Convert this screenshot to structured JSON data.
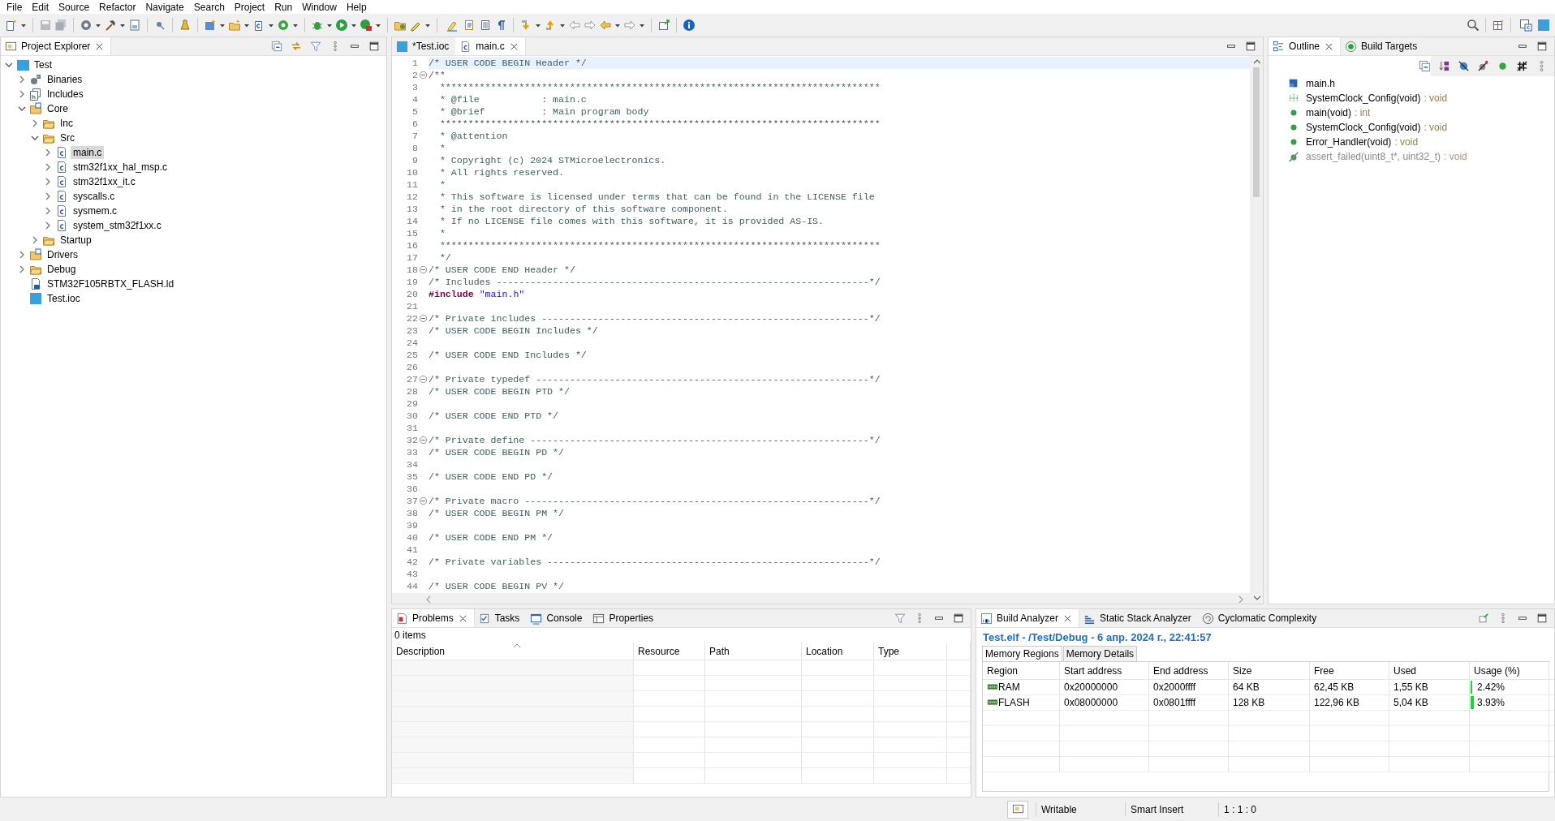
{
  "menu": [
    "File",
    "Edit",
    "Source",
    "Refactor",
    "Navigate",
    "Search",
    "Project",
    "Run",
    "Window",
    "Help"
  ],
  "project_explorer": {
    "title": "Project Explorer",
    "tree": [
      {
        "label": "Test",
        "kind": "project",
        "expanded": true,
        "selected": false,
        "children": [
          {
            "label": "Binaries",
            "kind": "binaries",
            "expanded": false,
            "selected": false
          },
          {
            "label": "Includes",
            "kind": "includes",
            "expanded": false,
            "selected": false
          },
          {
            "label": "Core",
            "kind": "source-folder",
            "expanded": true,
            "selected": false,
            "children": [
              {
                "label": "Inc",
                "kind": "folder",
                "expanded": false,
                "selected": false
              },
              {
                "label": "Src",
                "kind": "folder",
                "expanded": true,
                "selected": false,
                "children": [
                  {
                    "label": "main.c",
                    "kind": "c-file",
                    "expanded": false,
                    "selected": true
                  },
                  {
                    "label": "stm32f1xx_hal_msp.c",
                    "kind": "c-file",
                    "expanded": false,
                    "selected": false
                  },
                  {
                    "label": "stm32f1xx_it.c",
                    "kind": "c-file",
                    "expanded": false,
                    "selected": false
                  },
                  {
                    "label": "syscalls.c",
                    "kind": "c-file",
                    "expanded": false,
                    "selected": false
                  },
                  {
                    "label": "sysmem.c",
                    "kind": "c-file",
                    "expanded": false,
                    "selected": false
                  },
                  {
                    "label": "system_stm32f1xx.c",
                    "kind": "c-file",
                    "expanded": false,
                    "selected": false
                  }
                ]
              },
              {
                "label": "Startup",
                "kind": "folder",
                "expanded": false,
                "selected": false
              }
            ]
          },
          {
            "label": "Drivers",
            "kind": "source-folder",
            "expanded": false,
            "selected": false
          },
          {
            "label": "Debug",
            "kind": "folder",
            "expanded": false,
            "selected": false
          },
          {
            "label": "STM32F105RBTX_FLASH.ld",
            "kind": "linker-file",
            "expanded": false,
            "selected": false
          },
          {
            "label": "Test.ioc",
            "kind": "mx-file",
            "expanded": false,
            "selected": false
          }
        ]
      }
    ]
  },
  "editor": {
    "tabs": [
      {
        "label": "*Test.ioc",
        "kind": "mx",
        "selected": false
      },
      {
        "label": "main.c",
        "kind": "c",
        "selected": true
      }
    ],
    "lines": [
      {
        "n": "1",
        "kind": "comment",
        "text": "/* USER CODE BEGIN Header */",
        "fold": false,
        "current": true
      },
      {
        "n": "2",
        "kind": "comment",
        "text": "/**",
        "fold": true,
        "current": false
      },
      {
        "n": "3",
        "kind": "comment",
        "text": "  ******************************************************************************",
        "fold": false,
        "current": false
      },
      {
        "n": "4",
        "kind": "comment",
        "text": "  * @file           : main.c",
        "fold": false,
        "current": false
      },
      {
        "n": "5",
        "kind": "comment",
        "text": "  * @brief          : Main program body",
        "fold": false,
        "current": false
      },
      {
        "n": "6",
        "kind": "comment",
        "text": "  ******************************************************************************",
        "fold": false,
        "current": false
      },
      {
        "n": "7",
        "kind": "comment",
        "text": "  * @attention",
        "fold": false,
        "current": false
      },
      {
        "n": "8",
        "kind": "comment",
        "text": "  *",
        "fold": false,
        "current": false
      },
      {
        "n": "9",
        "kind": "comment",
        "text": "  * Copyright (c) 2024 STMicroelectronics.",
        "fold": false,
        "current": false
      },
      {
        "n": "10",
        "kind": "comment",
        "text": "  * All rights reserved.",
        "fold": false,
        "current": false
      },
      {
        "n": "11",
        "kind": "comment",
        "text": "  *",
        "fold": false,
        "current": false
      },
      {
        "n": "12",
        "kind": "comment",
        "text": "  * This software is licensed under terms that can be found in the LICENSE file",
        "fold": false,
        "current": false
      },
      {
        "n": "13",
        "kind": "comment",
        "text": "  * in the root directory of this software component.",
        "fold": false,
        "current": false
      },
      {
        "n": "14",
        "kind": "comment",
        "text": "  * If no LICENSE file comes with this software, it is provided AS-IS.",
        "fold": false,
        "current": false
      },
      {
        "n": "15",
        "kind": "comment",
        "text": "  *",
        "fold": false,
        "current": false
      },
      {
        "n": "16",
        "kind": "comment",
        "text": "  ******************************************************************************",
        "fold": false,
        "current": false
      },
      {
        "n": "17",
        "kind": "comment",
        "text": "  */",
        "fold": false,
        "current": false
      },
      {
        "n": "18",
        "kind": "comment",
        "text": "/* USER CODE END Header */",
        "fold": true,
        "current": false
      },
      {
        "n": "19",
        "kind": "comment",
        "text": "/* Includes ------------------------------------------------------------------*/",
        "fold": false,
        "current": false
      },
      {
        "n": "20",
        "kind": "include",
        "directive": "#include",
        "path": "\"main.h\"",
        "fold": false,
        "current": false
      },
      {
        "n": "21",
        "kind": "blank",
        "fold": false,
        "current": false
      },
      {
        "n": "22",
        "kind": "comment",
        "text": "/* Private includes ----------------------------------------------------------*/",
        "fold": true,
        "current": false
      },
      {
        "n": "23",
        "kind": "comment",
        "text": "/* USER CODE BEGIN Includes */",
        "fold": false,
        "current": false
      },
      {
        "n": "24",
        "kind": "blank",
        "fold": false,
        "current": false
      },
      {
        "n": "25",
        "kind": "comment",
        "text": "/* USER CODE END Includes */",
        "fold": false,
        "current": false
      },
      {
        "n": "26",
        "kind": "blank",
        "fold": false,
        "current": false
      },
      {
        "n": "27",
        "kind": "comment",
        "text": "/* Private typedef -----------------------------------------------------------*/",
        "fold": true,
        "current": false
      },
      {
        "n": "28",
        "kind": "comment",
        "text": "/* USER CODE BEGIN PTD */",
        "fold": false,
        "current": false
      },
      {
        "n": "29",
        "kind": "blank",
        "fold": false,
        "current": false
      },
      {
        "n": "30",
        "kind": "comment",
        "text": "/* USER CODE END PTD */",
        "fold": false,
        "current": false
      },
      {
        "n": "31",
        "kind": "blank",
        "fold": false,
        "current": false
      },
      {
        "n": "32",
        "kind": "comment",
        "text": "/* Private define ------------------------------------------------------------*/",
        "fold": true,
        "current": false
      },
      {
        "n": "33",
        "kind": "comment",
        "text": "/* USER CODE BEGIN PD */",
        "fold": false,
        "current": false
      },
      {
        "n": "34",
        "kind": "blank",
        "fold": false,
        "current": false
      },
      {
        "n": "35",
        "kind": "comment",
        "text": "/* USER CODE END PD */",
        "fold": false,
        "current": false
      },
      {
        "n": "36",
        "kind": "blank",
        "fold": false,
        "current": false
      },
      {
        "n": "37",
        "kind": "comment",
        "text": "/* Private macro -------------------------------------------------------------*/",
        "fold": true,
        "current": false
      },
      {
        "n": "38",
        "kind": "comment",
        "text": "/* USER CODE BEGIN PM */",
        "fold": false,
        "current": false
      },
      {
        "n": "39",
        "kind": "blank",
        "fold": false,
        "current": false
      },
      {
        "n": "40",
        "kind": "comment",
        "text": "/* USER CODE END PM */",
        "fold": false,
        "current": false
      },
      {
        "n": "41",
        "kind": "blank",
        "fold": false,
        "current": false
      },
      {
        "n": "42",
        "kind": "comment",
        "text": "/* Private variables ---------------------------------------------------------*/",
        "fold": false,
        "current": false
      },
      {
        "n": "43",
        "kind": "blank",
        "fold": false,
        "current": false
      },
      {
        "n": "44",
        "kind": "comment",
        "text": "/* USER CODE BEGIN PV */",
        "fold": false,
        "current": false
      }
    ]
  },
  "outline": {
    "tabs": [
      {
        "label": "Outline",
        "kind": "outline",
        "selected": true
      },
      {
        "label": "Build Targets",
        "kind": "targets",
        "selected": false
      }
    ],
    "items": [
      {
        "name": "main.h",
        "kind": "include",
        "disabled": false
      },
      {
        "name": "SystemClock_Config(void)",
        "type": ": void",
        "kind": "declaration",
        "disabled": false
      },
      {
        "name": "main(void)",
        "type": ": int",
        "kind": "function",
        "disabled": false
      },
      {
        "name": "SystemClock_Config(void)",
        "type": ": void",
        "kind": "function",
        "disabled": false
      },
      {
        "name": "Error_Handler(void)",
        "type": ": void",
        "kind": "function",
        "disabled": false
      },
      {
        "name": "assert_failed(uint8_t*, uint32_t)",
        "type": ": void",
        "kind": "excluded",
        "disabled": true
      }
    ]
  },
  "problems": {
    "tabs": [
      {
        "label": "Problems",
        "kind": "problems",
        "selected": true
      },
      {
        "label": "Tasks",
        "kind": "tasks",
        "selected": false
      },
      {
        "label": "Console",
        "kind": "console",
        "selected": false
      },
      {
        "label": "Properties",
        "kind": "properties",
        "selected": false
      }
    ],
    "summary": "0 items",
    "columns": [
      "Description",
      "Resource",
      "Path",
      "Location",
      "Type"
    ]
  },
  "build_analyzer": {
    "tabs": [
      {
        "label": "Build Analyzer",
        "kind": "binary",
        "selected": true
      },
      {
        "label": "Static Stack Analyzer",
        "kind": "stack",
        "selected": false
      },
      {
        "label": "Cyclomatic Complexity",
        "kind": "cyclomatic",
        "selected": false
      }
    ],
    "title": "Test.elf - /Test/Debug - 6 апр. 2024 г., 22:41:57",
    "subtabs": [
      {
        "label": "Memory Regions",
        "selected": true
      },
      {
        "label": "Memory Details",
        "selected": false
      }
    ],
    "columns": [
      "Region",
      "Start address",
      "End address",
      "Size",
      "Free",
      "Used",
      "Usage (%)"
    ],
    "rows": [
      {
        "region": "RAM",
        "start": "0x20000000",
        "end": "0x2000ffff",
        "size": "64 KB",
        "free": "62,45 KB",
        "used": "1,55 KB",
        "usage": "2.42%",
        "level": 0.0242
      },
      {
        "region": "FLASH",
        "start": "0x08000000",
        "end": "0x0801ffff",
        "size": "128 KB",
        "free": "122,96 KB",
        "used": "5,04 KB",
        "usage": "3.93%",
        "level": 0.0393
      }
    ]
  },
  "status_bar": [
    "Writable",
    "Smart Insert",
    "1 : 1 : 0"
  ]
}
